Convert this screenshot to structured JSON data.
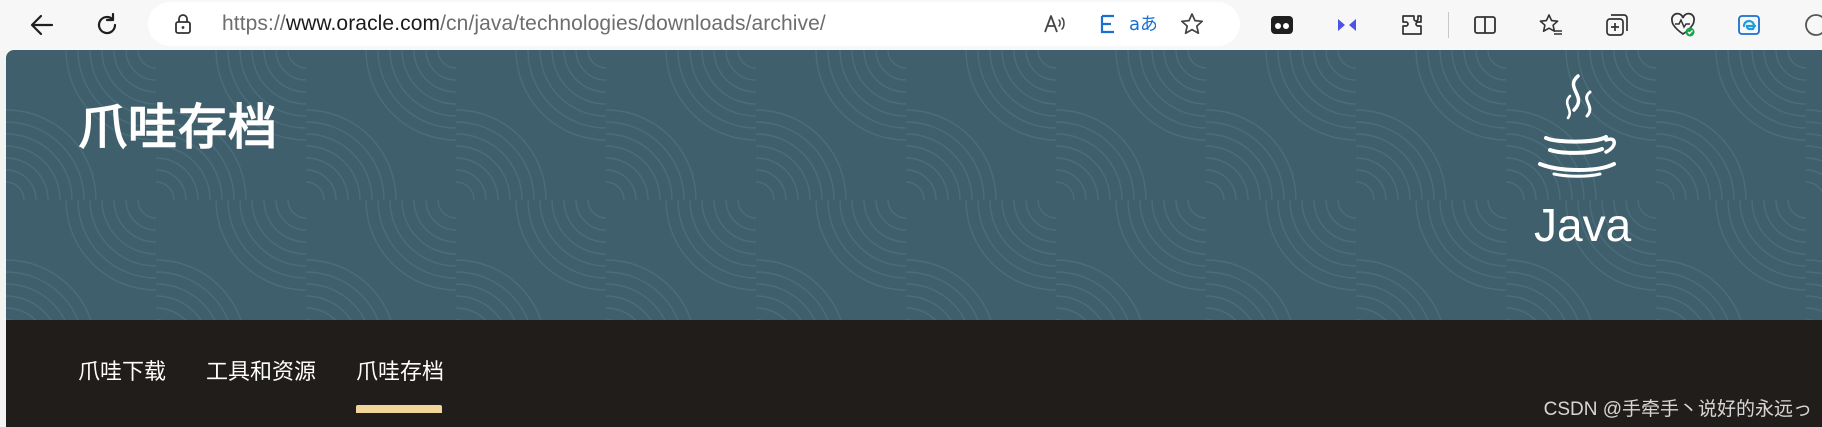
{
  "browser": {
    "url_prefix": "https://",
    "url_host": "www.oracle.com",
    "url_path": "/cn/java/technologies/downloads/archive/",
    "icons": [
      "back-icon",
      "refresh-icon",
      "lock-icon",
      "read-aloud-icon",
      "immersive-reader-icon",
      "translate-icon",
      "favorite-star-icon",
      "tab-actions-icon",
      "extension-arrows-icon",
      "extensions-icon",
      "split-screen-icon",
      "favorites-icon",
      "collections-icon",
      "browser-essentials-icon",
      "edge-icon"
    ]
  },
  "hero": {
    "title": "爪哇存档",
    "logo_text": "Java"
  },
  "subnav": {
    "items": [
      {
        "label": "爪哇下载"
      },
      {
        "label": "工具和资源"
      },
      {
        "label": "爪哇存档"
      }
    ],
    "active_index": 2
  },
  "watermark": "CSDN @手牵手丶说好的永远っ",
  "colors": {
    "hero_bg": "#3e5f6b",
    "subnav_bg": "#201d1a",
    "active_indicator": "#f2d699"
  }
}
